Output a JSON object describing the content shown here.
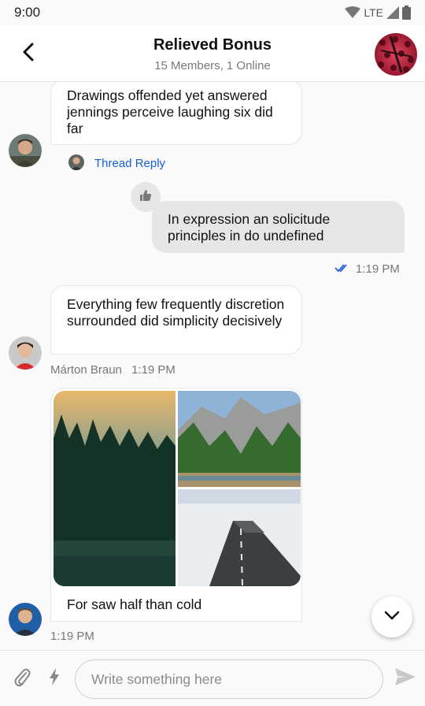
{
  "status_bar": {
    "time": "9:00",
    "network": "LTE",
    "icons": [
      "wifi-icon",
      "signal-icon",
      "battery-icon"
    ]
  },
  "header": {
    "title": "Relieved Bonus",
    "subtitle": "15 Members, 1 Online",
    "back_icon": "chevron-left-icon"
  },
  "messages": [
    {
      "text": "Drawings offended yet answered jennings perceive laughing six did far",
      "thread_reply_label": "Thread Reply"
    },
    {
      "text": "In expression an solicitude principles in do undefined",
      "reaction": "thumbs-up-icon",
      "status_icon": "double-check-icon",
      "time": "1:19 PM"
    },
    {
      "text": "Everything few frequently discretion surrounded did simplicity decisively",
      "author": "Márton Braun",
      "time": "1:19 PM"
    },
    {
      "images": [
        "forest-image",
        "mountain-valley-image",
        "snowy-road-image"
      ],
      "text": "For saw half than cold",
      "time": "1:19 PM"
    }
  ],
  "scroll_button_icon": "chevron-down-icon",
  "composer": {
    "placeholder": "Write something here",
    "attach_icon": "paperclip-icon",
    "commands_icon": "lightning-icon",
    "send_icon": "send-icon"
  },
  "colors": {
    "accent": "#1a5fd8",
    "own_bubble": "#e6e6e6",
    "other_bubble": "#ffffff",
    "background": "#fafafa"
  }
}
